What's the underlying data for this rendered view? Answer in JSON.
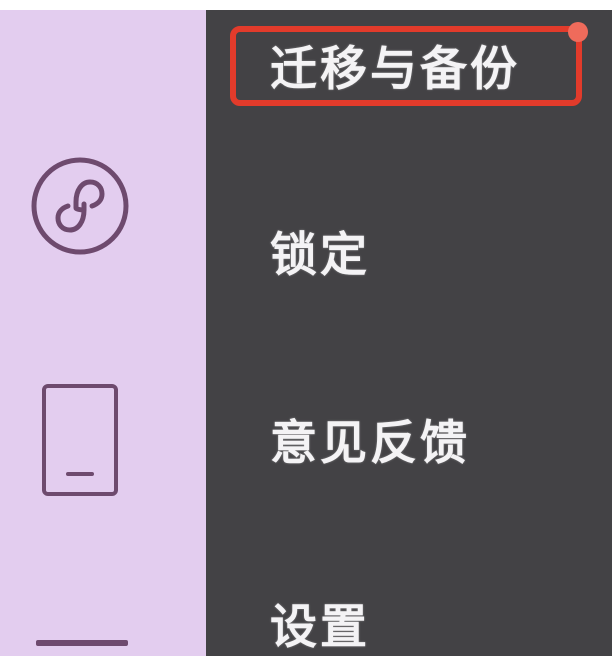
{
  "sidebar": {
    "icons": [
      "mini-program-icon",
      "phone-icon",
      "menu-bar-icon"
    ]
  },
  "menu": {
    "items": [
      {
        "label": "迁移与备份",
        "highlighted": true
      },
      {
        "label": "锁定"
      },
      {
        "label": "意见反馈"
      },
      {
        "label": "设置"
      }
    ]
  },
  "colors": {
    "sidebar_bg": "#e3cdef",
    "menu_bg": "#434245",
    "menu_text": "#f4f3f5",
    "highlight": "#e23b2b",
    "icon_stroke": "#6e4a6e"
  }
}
